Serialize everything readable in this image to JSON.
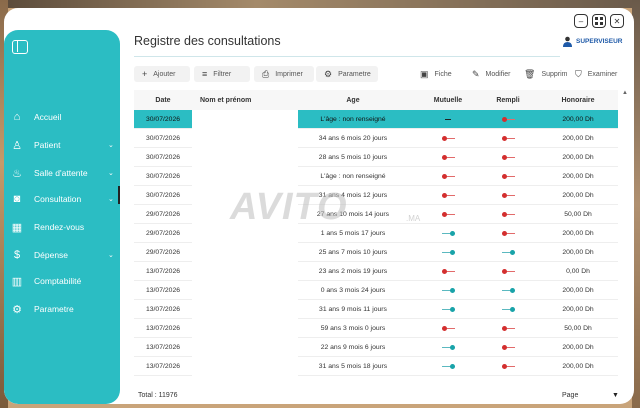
{
  "window": {
    "title": "Registre des consultations",
    "user_role": "SUPERVISEUR",
    "controls": [
      "minimize",
      "maximize",
      "close"
    ]
  },
  "sidebar": {
    "items": [
      {
        "label": "Accueil",
        "icon": "home-icon",
        "chevron": ""
      },
      {
        "label": "Patient",
        "icon": "person-icon",
        "chevron": "⌄"
      },
      {
        "label": "Salle d'attente",
        "icon": "waiting-room-icon",
        "chevron": "⌄"
      },
      {
        "label": "Consultation",
        "icon": "camera-icon",
        "chevron": "⌄"
      },
      {
        "label": "Rendez-vous",
        "icon": "calendar-icon",
        "chevron": ""
      },
      {
        "label": "Dépense",
        "icon": "dollar-icon",
        "chevron": "⌄"
      },
      {
        "label": "Comptabilité",
        "icon": "chart-icon",
        "chevron": ""
      },
      {
        "label": "Parametre",
        "icon": "gear-icon",
        "chevron": ""
      }
    ]
  },
  "toolbar": {
    "add": "Ajouter",
    "filter": "Filtrer",
    "print": "Imprimer",
    "settings": "Parametre",
    "sheet": "Fiche",
    "edit": "Modifier",
    "delete": "Supprimer",
    "examine": "Examiner"
  },
  "table": {
    "headers": [
      "Date",
      "Nom et prénom",
      "Age",
      "Mutuelle",
      "Rempli",
      "Honoraire"
    ],
    "rows": [
      {
        "date": "30/07/2026",
        "age": "L'âge : non renseigné",
        "mutuelle": "dash",
        "rempli": "off",
        "honoraire": "200,00 Dh",
        "selected": true
      },
      {
        "date": "30/07/2026",
        "age": "34 ans 6 mois 20 jours",
        "mutuelle": "off",
        "rempli": "off",
        "honoraire": "200,00 Dh",
        "selected": false
      },
      {
        "date": "30/07/2026",
        "age": "28 ans 5 mois 10 jours",
        "mutuelle": "off",
        "rempli": "off",
        "honoraire": "200,00 Dh",
        "selected": false
      },
      {
        "date": "30/07/2026",
        "age": "L'âge : non renseigné",
        "mutuelle": "off",
        "rempli": "off",
        "honoraire": "200,00 Dh",
        "selected": false
      },
      {
        "date": "30/07/2026",
        "age": "31 ans 4 mois 12 jours",
        "mutuelle": "off",
        "rempli": "off",
        "honoraire": "200,00 Dh",
        "selected": false
      },
      {
        "date": "29/07/2026",
        "age": "27 ans 10 mois 14 jours",
        "mutuelle": "off",
        "rempli": "off",
        "honoraire": "50,00 Dh",
        "selected": false
      },
      {
        "date": "29/07/2026",
        "age": "1 ans 5 mois 17 jours",
        "mutuelle": "on",
        "rempli": "off",
        "honoraire": "200,00 Dh",
        "selected": false
      },
      {
        "date": "29/07/2026",
        "age": "25 ans 7 mois 10 jours",
        "mutuelle": "on",
        "rempli": "on",
        "honoraire": "200,00 Dh",
        "selected": false
      },
      {
        "date": "13/07/2026",
        "age": "23 ans 2 mois 19 jours",
        "mutuelle": "off",
        "rempli": "off",
        "honoraire": "0,00 Dh",
        "selected": false
      },
      {
        "date": "13/07/2026",
        "age": "0 ans 3 mois 24 jours",
        "mutuelle": "on",
        "rempli": "on",
        "honoraire": "200,00 Dh",
        "selected": false
      },
      {
        "date": "13/07/2026",
        "age": "31 ans 9 mois 11 jours",
        "mutuelle": "on",
        "rempli": "on",
        "honoraire": "200,00 Dh",
        "selected": false
      },
      {
        "date": "13/07/2026",
        "age": "59 ans 3 mois 0 jours",
        "mutuelle": "off",
        "rempli": "off",
        "honoraire": "50,00 Dh",
        "selected": false
      },
      {
        "date": "13/07/2026",
        "age": "22 ans 9 mois 6 jours",
        "mutuelle": "on",
        "rempli": "off",
        "honoraire": "200,00 Dh",
        "selected": false
      },
      {
        "date": "13/07/2026",
        "age": "31 ans 5 mois 18 jours",
        "mutuelle": "on",
        "rempli": "off",
        "honoraire": "200,00 Dh",
        "selected": false
      }
    ]
  },
  "footer": {
    "total": "Total : 11976",
    "page": "Page"
  },
  "watermark": {
    "text": "AVITO",
    "sub": ".MA"
  },
  "colors": {
    "accent": "#2bbdc3",
    "off": "#d32f2f",
    "on": "#19a3a9",
    "user": "#1f5aa8"
  }
}
